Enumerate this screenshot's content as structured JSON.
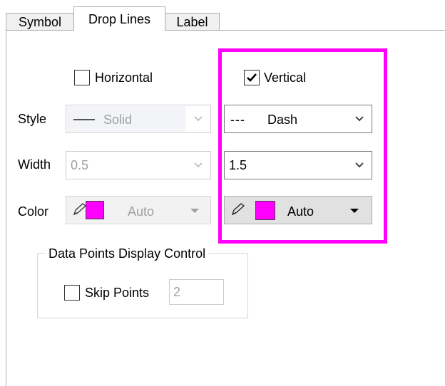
{
  "tabs": [
    {
      "label": "Symbol",
      "active": false
    },
    {
      "label": "Drop Lines",
      "active": true
    },
    {
      "label": "Label",
      "active": false
    }
  ],
  "horizontal": {
    "label": "Horizontal",
    "checked": false
  },
  "vertical": {
    "label": "Vertical",
    "checked": true
  },
  "rows": {
    "style_label": "Style",
    "width_label": "Width",
    "color_label": "Color"
  },
  "horizontal_controls": {
    "style_value": "Solid",
    "width_value": "0.5",
    "color_value": "Auto",
    "color_swatch": "#ff00ff",
    "enabled": false
  },
  "vertical_controls": {
    "style_value": "Dash",
    "width_value": "1.5",
    "color_value": "Auto",
    "color_swatch": "#ff00ff",
    "enabled": true
  },
  "data_points_group": {
    "title": "Data Points Display Control",
    "skip_points_label": "Skip Points",
    "skip_points_checked": false,
    "skip_points_value": "2"
  },
  "highlight_color": "#ff00ff"
}
